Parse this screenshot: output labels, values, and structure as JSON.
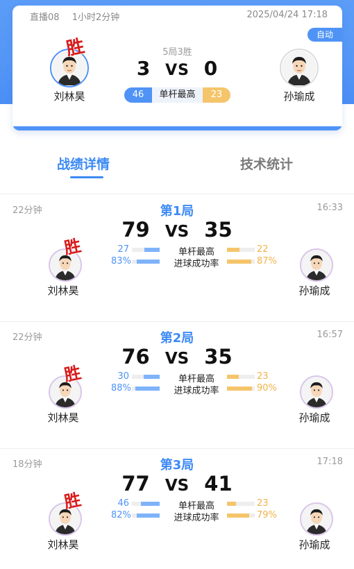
{
  "summary": {
    "channel": "直播08",
    "duration": "1小时2分钟",
    "datetime": "2025/04/24 17:18",
    "badge": "自动",
    "format": "5局3胜",
    "score_left": "3",
    "vs": "VS",
    "score_right": "0",
    "win_mark": "胜",
    "player_left": "刘林昊",
    "player_right": "孙瑜成",
    "stat_left": "46",
    "stat_label": "单杆最高",
    "stat_right": "23"
  },
  "tabs": [
    {
      "label": "战绩详情",
      "active": true
    },
    {
      "label": "技术统计",
      "active": false
    }
  ],
  "rounds": [
    {
      "duration": "22分钟",
      "title": "第1局",
      "time": "16:33",
      "score_left": "79",
      "vs": "VS",
      "score_right": "35",
      "win_mark": "胜",
      "player_left": "刘林昊",
      "player_right": "孙瑜成",
      "stats": [
        {
          "left": "27",
          "label": "单杆最高",
          "right": "22",
          "left_fill": 0.55,
          "right_fill": 0.45
        },
        {
          "left": "83%",
          "label": "进球成功率",
          "right": "87%",
          "left_fill": 0.83,
          "right_fill": 0.87
        }
      ]
    },
    {
      "duration": "22分钟",
      "title": "第2局",
      "time": "16:57",
      "score_left": "76",
      "vs": "VS",
      "score_right": "35",
      "win_mark": "胜",
      "player_left": "刘林昊",
      "player_right": "孙瑜成",
      "stats": [
        {
          "left": "30",
          "label": "单杆最高",
          "right": "23",
          "left_fill": 0.57,
          "right_fill": 0.43
        },
        {
          "left": "88%",
          "label": "进球成功率",
          "right": "90%",
          "left_fill": 0.88,
          "right_fill": 0.9
        }
      ]
    },
    {
      "duration": "18分钟",
      "title": "第3局",
      "time": "17:18",
      "score_left": "77",
      "vs": "VS",
      "score_right": "41",
      "win_mark": "胜",
      "player_left": "刘林昊",
      "player_right": "孙瑜成",
      "stats": [
        {
          "left": "46",
          "label": "单杆最高",
          "right": "23",
          "left_fill": 0.67,
          "right_fill": 0.33
        },
        {
          "left": "82%",
          "label": "进球成功率",
          "right": "79%",
          "left_fill": 0.82,
          "right_fill": 0.79
        }
      ]
    }
  ],
  "colors": {
    "accent_blue": "#4f93f6",
    "accent_orange": "#f5c56b",
    "win_red": "#d71c1c"
  }
}
